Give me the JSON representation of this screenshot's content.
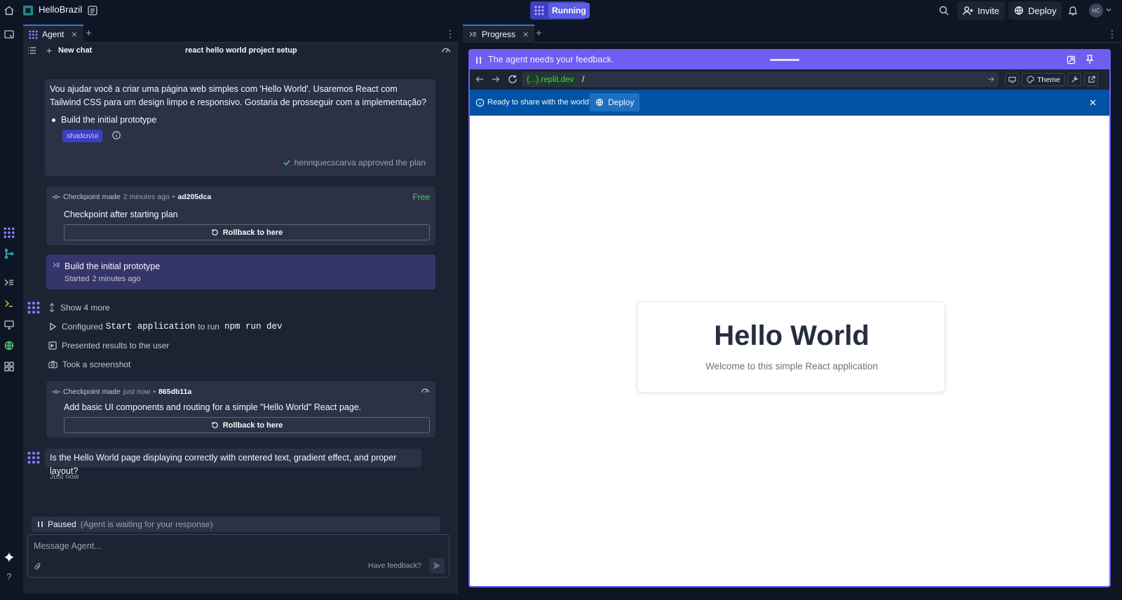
{
  "topbar": {
    "app_title": "HelloBrazil",
    "run_label": "Running",
    "invite_label": "Invite",
    "deploy_label": "Deploy",
    "avatar_initials": "HC"
  },
  "left": {
    "tab_label": "Agent",
    "new_chat": "New chat",
    "chat_title": "react hello world project setup",
    "plan_message": "Vou ajudar você a criar uma página web simples com 'Hello World'. Usaremos React com Tailwind CSS para um design limpo e responsivo. Gostaria de prosseguir com a implementação?",
    "plan_item": "Build the initial prototype",
    "plan_chip": "shadcn/ui",
    "approved_text": "henriquecscarva approved the plan",
    "checkpoint1": {
      "made": "Checkpoint made",
      "time": "2 minutes ago",
      "hash": "ad205dca",
      "badge": "Free",
      "title": "Checkpoint after starting plan",
      "rollback": "Rollback to here"
    },
    "task": {
      "title": "Build the initial prototype",
      "started": "Started",
      "time": "2 minutes ago"
    },
    "actions": {
      "show_more": "Show 4 more",
      "configured_prefix": "Configured",
      "configured_cmd": "Start application",
      "configured_mid": "to run",
      "configured_run": "npm run dev",
      "presented": "Presented results to the user",
      "screenshot": "Took a screenshot"
    },
    "checkpoint2": {
      "made": "Checkpoint made",
      "time": "just now",
      "hash": "865db11a",
      "title": "Add basic UI components and routing for a simple \"Hello World\" React page.",
      "rollback": "Rollback to here"
    },
    "question": "Is the Hello World page displaying correctly with centered text, gradient effect, and proper layout?",
    "question_time": "Just now",
    "paused_label": "Paused",
    "paused_sub": "(Agent is waiting for your response)",
    "composer_placeholder": "Message Agent...",
    "feedback_label": "Have feedback?"
  },
  "right": {
    "tab_label": "Progress",
    "feedback_banner": "The agent needs your feedback.",
    "url_host": "{...}.replit.dev",
    "url_path": "/",
    "theme_label": "Theme",
    "share_text": "Ready to share with the world?",
    "deploy_label": "Deploy",
    "hello_title": "Hello World",
    "hello_sub": "Welcome to this simple React application"
  },
  "colors": {
    "bg": "#0e1525",
    "surface": "#1c2333",
    "card": "#2b3245",
    "accent": "#6f5ef0",
    "run": "#3c3fc0",
    "free": "#4ec96a",
    "banner": "#0053a6"
  }
}
